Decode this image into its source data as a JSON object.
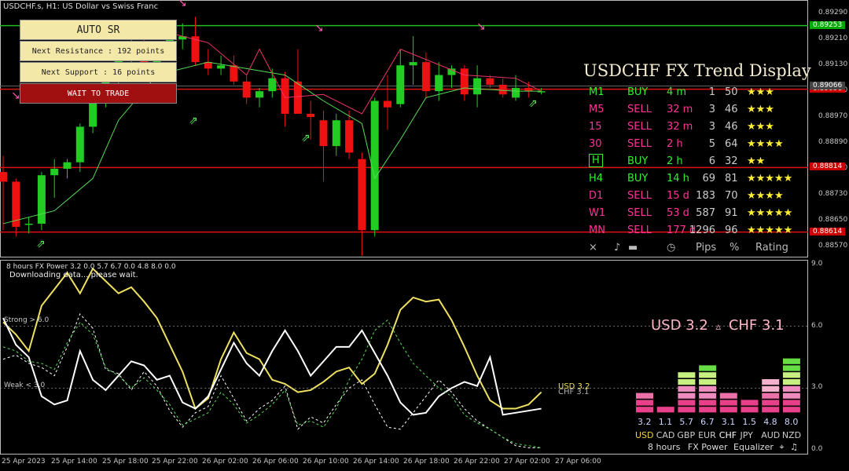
{
  "window": {
    "title": "USDCHF.s, H1:  US Dollar vs Swiss Franc",
    "indicator_title": "8 hours FX Power 3.2 0.0 5.7 6.7 0.0 4.8 8.0 0.0",
    "status_text": "Downloading data... please wait."
  },
  "price_axis": {
    "labels": [
      "0.89290",
      "0.89210",
      "0.89130",
      "0.89050",
      "0.88970",
      "0.88890",
      "0.88810",
      "0.88730",
      "0.88650",
      "0.88570"
    ],
    "highlight_tags": [
      {
        "label": "0.89253",
        "color": "#0a0"
      },
      {
        "label": "0.89056",
        "color": "#c00"
      },
      {
        "label": "0.89066",
        "color": "#444"
      },
      {
        "label": "0.88814",
        "color": "#c00"
      },
      {
        "label": "0.88614",
        "color": "#c00"
      }
    ]
  },
  "sub_axis": {
    "labels": [
      "9.0",
      "6.0",
      "3.0",
      "0.0"
    ]
  },
  "time_axis": {
    "labels": [
      "25 Apr 2023",
      "25 Apr 14:00",
      "25 Apr 18:00",
      "25 Apr 22:00",
      "26 Apr 02:00",
      "26 Apr 06:00",
      "26 Apr 10:00",
      "26 Apr 14:00",
      "26 Apr 18:00",
      "26 Apr 22:00",
      "27 Apr 02:00",
      "27 Apr 06:00"
    ]
  },
  "auto_sr": {
    "title": "AUTO SR",
    "next_resistance": "Next Resistance : 192 points",
    "next_support": "Next Support : 16 points",
    "status": "WAIT TO TRADE"
  },
  "trend_display": {
    "title": "USDCHF FX Trend Display",
    "rows": [
      {
        "tf": "M1",
        "signal": "BUY",
        "age": "4 m",
        "pips": "1",
        "pct": "50",
        "stars": "★★★",
        "color": "#33ee33"
      },
      {
        "tf": "M5",
        "signal": "SELL",
        "age": "32 m",
        "pips": "3",
        "pct": "46",
        "stars": "★★★",
        "color": "#ff3399"
      },
      {
        "tf": "15",
        "signal": "SELL",
        "age": "32 m",
        "pips": "3",
        "pct": "46",
        "stars": "★★★",
        "color": "#ff3399"
      },
      {
        "tf": "30",
        "signal": "SELL",
        "age": "2 h",
        "pips": "5",
        "pct": "64",
        "stars": "★★★★",
        "color": "#ff3399"
      },
      {
        "tf": "H",
        "signal": "BUY",
        "age": "2 h",
        "pips": "6",
        "pct": "32",
        "stars": "★★",
        "color": "#33ee33"
      },
      {
        "tf": "H4",
        "signal": "BUY",
        "age": "14 h",
        "pips": "69",
        "pct": "81",
        "stars": "★★★★★",
        "color": "#33ee33"
      },
      {
        "tf": "D1",
        "signal": "SELL",
        "age": "15 d",
        "pips": "183",
        "pct": "70",
        "stars": "★★★★",
        "color": "#ff3399"
      },
      {
        "tf": "W1",
        "signal": "SELL",
        "age": "53 d",
        "pips": "587",
        "pct": "91",
        "stars": "★★★★★",
        "color": "#ff3399"
      },
      {
        "tf": "MN",
        "signal": "SELL",
        "age": "177 d",
        "pips": "1296",
        "pct": "96",
        "stars": "★★★★★",
        "color": "#ff3399"
      }
    ],
    "footer": {
      "close": "×",
      "sound": "♪",
      "time": "◷",
      "pips": "Pips",
      "pct": "%",
      "rating": "Rating"
    }
  },
  "levels": {
    "strong": "Strong > 6.0",
    "weak": "Weak < 3.0"
  },
  "fx_power": {
    "headline_left": "USD 3.2",
    "headline_arrow": "▵",
    "headline_right": "CHF 3.1",
    "line_label_usd": "USD 3.2",
    "line_label_chf": "CHF 3.1",
    "footer_hours": "8 hours",
    "footer_name": "FX Power",
    "footer_equalizer": "Equalizer",
    "currencies": [
      {
        "name": "USD",
        "value": "3.2",
        "level": 3.2,
        "color": "#f0d040"
      },
      {
        "name": "CAD",
        "value": "1.1",
        "level": 1.1,
        "color": "#cccccc"
      },
      {
        "name": "GBP",
        "value": "5.7",
        "level": 5.7,
        "color": "#cccccc"
      },
      {
        "name": "EUR",
        "value": "6.7",
        "level": 6.7,
        "color": "#cccccc"
      },
      {
        "name": "CHF",
        "value": "3.1",
        "level": 3.1,
        "color": "#ffffff"
      },
      {
        "name": "JPY",
        "value": "1.5",
        "level": 1.5,
        "color": "#cccccc"
      },
      {
        "name": "AUD",
        "value": "4.8",
        "level": 4.8,
        "color": "#cccccc"
      },
      {
        "name": "NZD",
        "value": "8.0",
        "level": 8.0,
        "color": "#cccccc"
      }
    ]
  },
  "chart_data": {
    "type": "candlestick",
    "symbol": "USDCHF.s",
    "timeframe": "H1",
    "ylim": [
      0.8855,
      0.8932
    ],
    "levels": [
      0.89253,
      0.89056,
      0.88814,
      0.88614
    ],
    "candles": [
      {
        "o": 0.888,
        "h": 0.8885,
        "l": 0.8862,
        "c": 0.8877
      },
      {
        "o": 0.8877,
        "h": 0.8878,
        "l": 0.886,
        "c": 0.8863
      },
      {
        "o": 0.8864,
        "h": 0.8866,
        "l": 0.8861,
        "c": 0.8864
      },
      {
        "o": 0.8864,
        "h": 0.888,
        "l": 0.8862,
        "c": 0.8879
      },
      {
        "o": 0.8879,
        "h": 0.8884,
        "l": 0.8872,
        "c": 0.8881
      },
      {
        "o": 0.8881,
        "h": 0.8884,
        "l": 0.8878,
        "c": 0.8883
      },
      {
        "o": 0.8883,
        "h": 0.8895,
        "l": 0.888,
        "c": 0.8894
      },
      {
        "o": 0.8894,
        "h": 0.8905,
        "l": 0.8892,
        "c": 0.8903
      },
      {
        "o": 0.8903,
        "h": 0.8912,
        "l": 0.89,
        "c": 0.891
      },
      {
        "o": 0.891,
        "h": 0.892,
        "l": 0.8905,
        "c": 0.8917
      },
      {
        "o": 0.8917,
        "h": 0.8923,
        "l": 0.8912,
        "c": 0.8919
      },
      {
        "o": 0.8919,
        "h": 0.8925,
        "l": 0.8914,
        "c": 0.8914
      },
      {
        "o": 0.8914,
        "h": 0.892,
        "l": 0.8912,
        "c": 0.8918
      },
      {
        "o": 0.8918,
        "h": 0.8922,
        "l": 0.8915,
        "c": 0.8921
      },
      {
        "o": 0.8921,
        "h": 0.8926,
        "l": 0.8918,
        "c": 0.8922
      },
      {
        "o": 0.8922,
        "h": 0.8928,
        "l": 0.8913,
        "c": 0.8914
      },
      {
        "o": 0.8914,
        "h": 0.8918,
        "l": 0.891,
        "c": 0.8912
      },
      {
        "o": 0.8912,
        "h": 0.8916,
        "l": 0.891,
        "c": 0.8913
      },
      {
        "o": 0.8913,
        "h": 0.8916,
        "l": 0.8907,
        "c": 0.8908
      },
      {
        "o": 0.8908,
        "h": 0.891,
        "l": 0.8901,
        "c": 0.8903
      },
      {
        "o": 0.8903,
        "h": 0.8906,
        "l": 0.89,
        "c": 0.8905
      },
      {
        "o": 0.8905,
        "h": 0.8912,
        "l": 0.8903,
        "c": 0.8909
      },
      {
        "o": 0.8909,
        "h": 0.8911,
        "l": 0.8894,
        "c": 0.8898
      },
      {
        "o": 0.8908,
        "h": 0.8918,
        "l": 0.8898,
        "c": 0.8898
      },
      {
        "o": 0.8898,
        "h": 0.8902,
        "l": 0.889,
        "c": 0.8897
      },
      {
        "o": 0.8896,
        "h": 0.8899,
        "l": 0.8877,
        "c": 0.8888
      },
      {
        "o": 0.8888,
        "h": 0.8898,
        "l": 0.8885,
        "c": 0.8896
      },
      {
        "o": 0.8896,
        "h": 0.8899,
        "l": 0.8884,
        "c": 0.8886
      },
      {
        "o": 0.8884,
        "h": 0.8886,
        "l": 0.8854,
        "c": 0.8862
      },
      {
        "o": 0.8862,
        "h": 0.8903,
        "l": 0.886,
        "c": 0.8902
      },
      {
        "o": 0.8902,
        "h": 0.891,
        "l": 0.8893,
        "c": 0.89
      },
      {
        "o": 0.8901,
        "h": 0.8918,
        "l": 0.89,
        "c": 0.8913
      },
      {
        "o": 0.8913,
        "h": 0.8922,
        "l": 0.8907,
        "c": 0.8914
      },
      {
        "o": 0.8914,
        "h": 0.8917,
        "l": 0.8903,
        "c": 0.8905
      },
      {
        "o": 0.8905,
        "h": 0.8914,
        "l": 0.8902,
        "c": 0.891
      },
      {
        "o": 0.891,
        "h": 0.8913,
        "l": 0.8906,
        "c": 0.8912
      },
      {
        "o": 0.8912,
        "h": 0.8913,
        "l": 0.8902,
        "c": 0.8904
      },
      {
        "o": 0.8904,
        "h": 0.8913,
        "l": 0.89,
        "c": 0.8909
      },
      {
        "o": 0.8909,
        "h": 0.891,
        "l": 0.8906,
        "c": 0.8907
      },
      {
        "o": 0.8907,
        "h": 0.8909,
        "l": 0.8903,
        "c": 0.8904
      },
      {
        "o": 0.8903,
        "h": 0.891,
        "l": 0.8902,
        "c": 0.8906
      },
      {
        "o": 0.8906,
        "h": 0.8908,
        "l": 0.8903,
        "c": 0.8905
      },
      {
        "o": 0.8905,
        "h": 0.8906,
        "l": 0.8904,
        "c": 0.8905
      }
    ],
    "trend_line": [
      [
        0,
        0.8864
      ],
      [
        4,
        0.8868
      ],
      [
        7,
        0.8878
      ],
      [
        9,
        0.8896
      ],
      [
        12,
        0.891
      ],
      [
        16,
        0.8914
      ],
      [
        19,
        0.8912
      ],
      [
        22,
        0.891
      ],
      [
        25,
        0.8902
      ],
      [
        28,
        0.8895
      ],
      [
        29,
        0.8878
      ],
      [
        31,
        0.889
      ],
      [
        33,
        0.8903
      ],
      [
        36,
        0.8906
      ],
      [
        40,
        0.8905
      ],
      [
        42,
        0.8905
      ]
    ],
    "resistance_line": [
      [
        12,
        0.8924
      ],
      [
        16,
        0.892
      ],
      [
        19,
        0.891
      ],
      [
        20,
        0.8918
      ],
      [
        22,
        0.8903
      ],
      [
        25,
        0.8904
      ],
      [
        28,
        0.8898
      ],
      [
        31,
        0.8918
      ],
      [
        36,
        0.891
      ],
      [
        40,
        0.8909
      ],
      [
        42,
        0.8905
      ]
    ],
    "strength_series": [
      {
        "name": "USD",
        "color": "#f0e060",
        "style": "solid",
        "values": [
          6.2,
          5.6,
          4.8,
          7.0,
          7.8,
          8.6,
          7.6,
          8.8,
          8.2,
          7.6,
          7.9,
          7.2,
          6.4,
          5.1,
          3.8,
          2.0,
          2.5,
          4.4,
          5.7,
          4.7,
          4.4,
          3.4,
          3.2,
          2.8,
          2.9,
          3.3,
          3.8,
          4.0,
          3.2,
          3.7,
          5.1,
          6.8,
          7.4,
          7.2,
          7.3,
          6.3,
          5.0,
          3.6,
          2.4,
          2.0,
          2.0,
          2.2,
          2.8
        ]
      },
      {
        "name": "CHF",
        "color": "#ffffff",
        "style": "solid",
        "values": [
          6.4,
          5.1,
          4.5,
          2.6,
          2.2,
          2.4,
          4.8,
          3.4,
          2.9,
          3.6,
          4.3,
          4.1,
          3.4,
          3.6,
          2.3,
          2.0,
          2.6,
          3.9,
          5.2,
          4.2,
          3.6,
          4.8,
          5.8,
          4.8,
          3.6,
          4.3,
          5.0,
          5.0,
          5.8,
          4.7,
          3.6,
          2.3,
          1.7,
          1.8,
          2.6,
          3.0,
          3.3,
          3.1,
          4.5,
          1.7,
          1.8,
          1.9,
          2.0
        ]
      },
      {
        "name": "EUR",
        "color": "#ffffff",
        "style": "dashed",
        "values": [
          4.4,
          4.6,
          4.2,
          4.0,
          3.6,
          5.0,
          6.6,
          5.9,
          3.9,
          3.7,
          2.9,
          3.8,
          3.1,
          1.9,
          1.1,
          1.8,
          2.1,
          3.6,
          2.5,
          1.4,
          2.0,
          2.4,
          3.1,
          1.0,
          1.6,
          1.3,
          2.2,
          3.0,
          3.4,
          2.2,
          1.1,
          1.0,
          1.8,
          2.6,
          3.4,
          2.8,
          2.0,
          1.4,
          1.0,
          0.6,
          0.2,
          0.1,
          0.1
        ]
      },
      {
        "name": "GBP",
        "color": "#55dd55",
        "style": "dashed",
        "values": [
          5.0,
          4.8,
          4.3,
          4.2,
          3.9,
          5.2,
          6.2,
          5.6,
          4.0,
          3.6,
          3.0,
          3.5,
          2.9,
          2.2,
          1.2,
          1.5,
          1.8,
          2.8,
          2.2,
          1.3,
          1.7,
          2.2,
          2.9,
          1.2,
          1.4,
          1.1,
          2.0,
          3.4,
          4.4,
          5.8,
          6.3,
          5.2,
          4.2,
          3.6,
          3.0,
          2.6,
          1.7,
          1.3,
          1.0,
          0.6,
          0.3,
          0.2,
          0.1
        ]
      }
    ]
  }
}
